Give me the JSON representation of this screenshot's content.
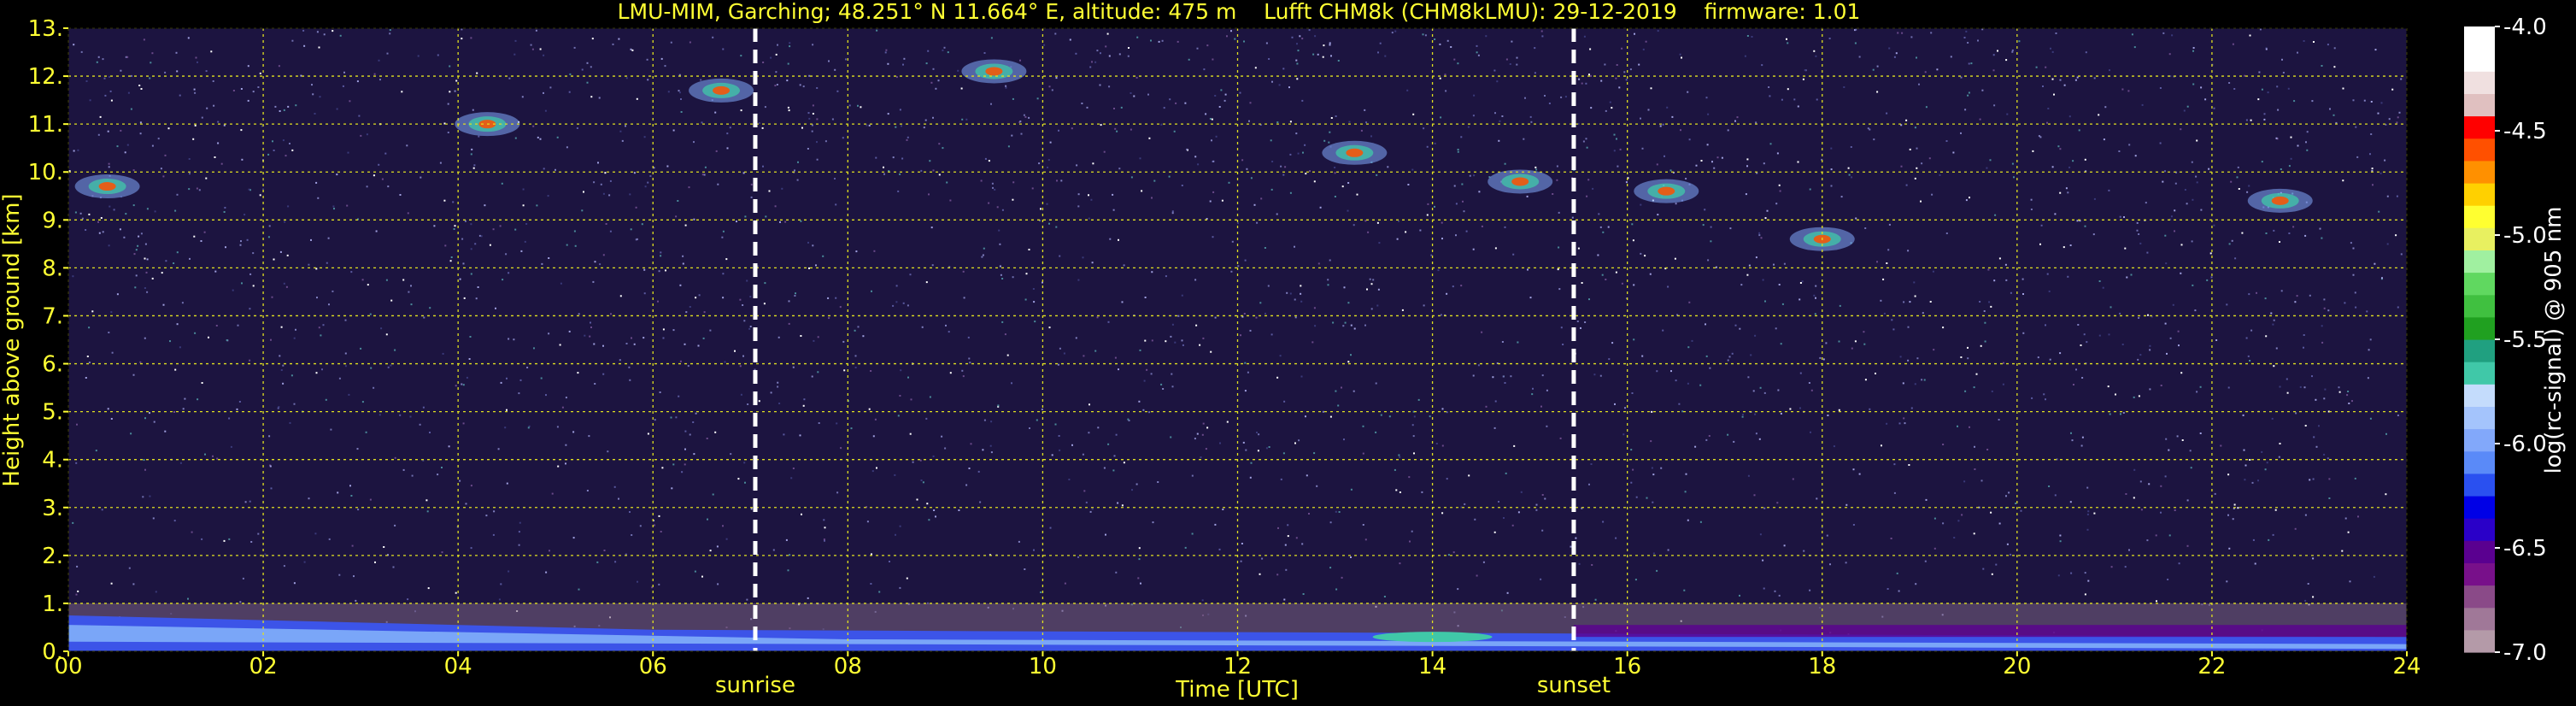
{
  "chart_data": {
    "type": "heatmap",
    "title": "LMU-MIM, Garching; 48.251° N 11.664° E, altitude: 475 m    Lufft CHM8k (CHM8kLMU): 29-12-2019    firmware: 1.01",
    "xlabel": "Time [UTC]",
    "ylabel": "Height above ground [km]",
    "xlim": [
      0,
      24
    ],
    "ylim": [
      0,
      13
    ],
    "x_ticks": [
      "00",
      "02",
      "04",
      "06",
      "08",
      "10",
      "12",
      "14",
      "16",
      "18",
      "20",
      "22",
      "24"
    ],
    "y_ticks": [
      "0.",
      "1.",
      "2.",
      "3.",
      "4.",
      "5.",
      "6.",
      "7.",
      "8.",
      "9.",
      "10.",
      "11.",
      "12.",
      "13."
    ],
    "grid": true,
    "vertical_markers": [
      {
        "label": "sunrise",
        "time": 7.05
      },
      {
        "label": "sunset",
        "time": 15.45
      }
    ],
    "colorbar": {
      "label": "log(rc-signal) @ 905 nm",
      "range": [
        -7.0,
        -4.0
      ],
      "ticks": [
        "-4.0",
        "-4.5",
        "-5.0",
        "-5.5",
        "-6.0",
        "-6.5",
        "-7.0"
      ],
      "colors": [
        "#b49aa8",
        "#a07898",
        "#8a4a88",
        "#78108a",
        "#5a0090",
        "#2a00c8",
        "#0000e6",
        "#2a50f0",
        "#5a8af8",
        "#82a8fa",
        "#a4c4fc",
        "#c4dcfc",
        "#40c8a8",
        "#20a080",
        "#20a020",
        "#40c040",
        "#60d860",
        "#a0f0a0",
        "#e8f060",
        "#ffff30",
        "#ffd000",
        "#ff9000",
        "#ff5000",
        "#ff0000",
        "#e0c0c0",
        "#f0e0e0",
        "#ffffff",
        "#ffffff"
      ]
    },
    "features": [
      {
        "type": "boundary-layer",
        "time_start": 0,
        "time_end": 24,
        "height_start_km": 0.75,
        "height_end_km": 0.3
      },
      {
        "type": "cloud",
        "time": 0.4,
        "height_km": 9.7
      },
      {
        "type": "cloud",
        "time": 4.3,
        "height_km": 11.0
      },
      {
        "type": "cloud",
        "time": 6.7,
        "height_km": 11.7
      },
      {
        "type": "cloud",
        "time": 9.5,
        "height_km": 12.1
      },
      {
        "type": "cloud",
        "time": 13.2,
        "height_km": 10.4
      },
      {
        "type": "cloud",
        "time": 14.9,
        "height_km": 9.8
      },
      {
        "type": "cloud",
        "time": 16.4,
        "height_km": 9.6
      },
      {
        "type": "cloud",
        "time": 18.0,
        "height_km": 8.6
      },
      {
        "type": "cloud",
        "time": 22.7,
        "height_km": 9.4
      }
    ]
  }
}
